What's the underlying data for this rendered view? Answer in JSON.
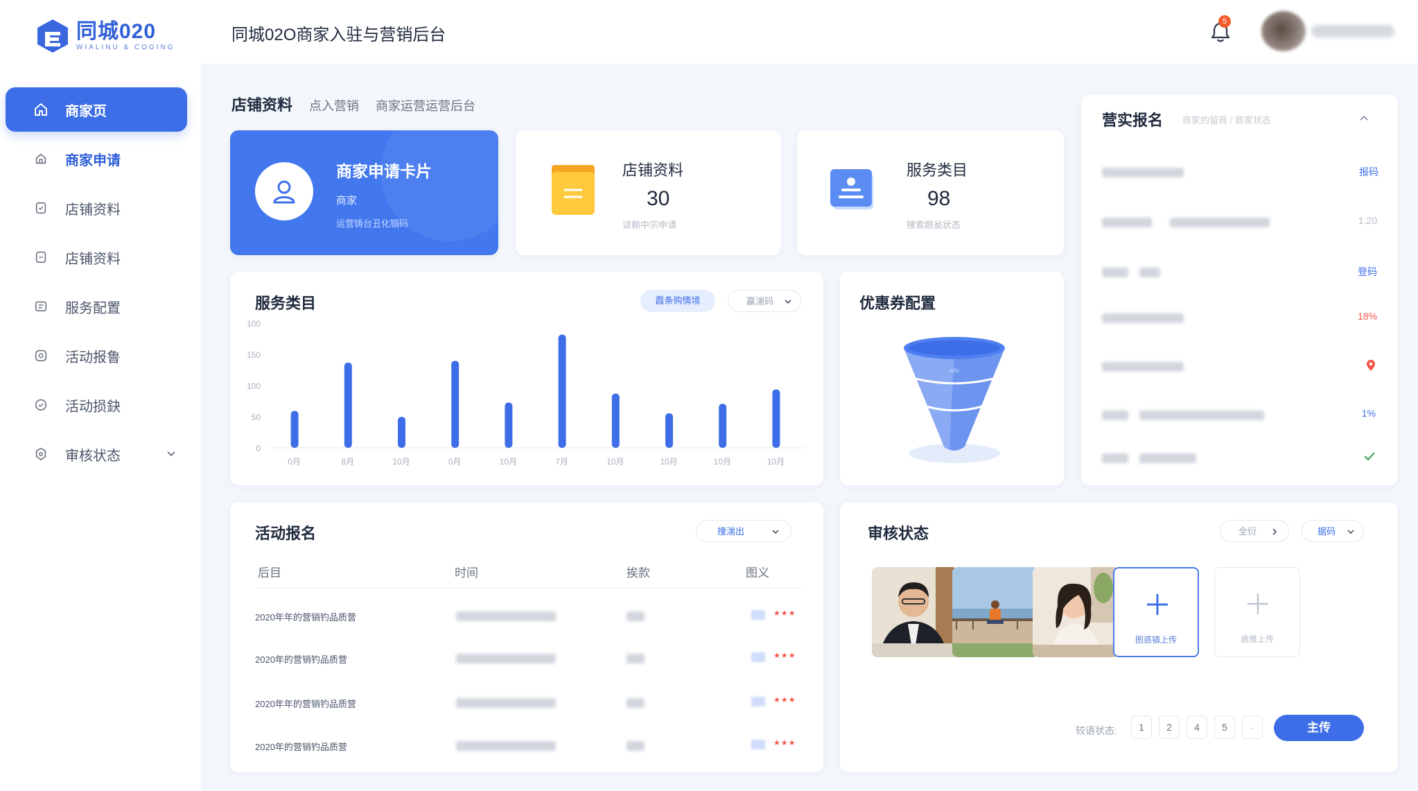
{
  "app": {
    "name": "同城020",
    "tagline": "WIALINU & COGING"
  },
  "header": {
    "title": "同城02O商家入驻与营销后台",
    "notification_count": "5"
  },
  "sidebar": {
    "items": [
      {
        "label": "商家页",
        "icon": "home-icon",
        "state": "active"
      },
      {
        "label": "商家申请",
        "icon": "home-outline-icon",
        "state": "highlight"
      },
      {
        "label": "店铺资料",
        "icon": "shield-doc-icon",
        "state": "normal"
      },
      {
        "label": "店铺资料",
        "icon": "document-icon",
        "state": "normal"
      },
      {
        "label": "服务配置",
        "icon": "list-box-icon",
        "state": "normal"
      },
      {
        "label": "活动报鲁",
        "icon": "target-icon",
        "state": "normal"
      },
      {
        "label": "活动损鈌",
        "icon": "check-circle-icon",
        "state": "normal"
      },
      {
        "label": "审核状态",
        "icon": "gear-shield-icon",
        "state": "normal",
        "has_submenu": true
      }
    ]
  },
  "tabs": [
    {
      "label": "店铺资料",
      "active": true
    },
    {
      "label": "点入营销",
      "active": false
    },
    {
      "label": "商家运营运营后台",
      "active": false
    }
  ],
  "merchant_card": {
    "title": "商家申请卡片",
    "subtitle": "商家",
    "note": "运营铸台丑化锢码"
  },
  "stat_cards": [
    {
      "title": "店铺资料",
      "value": "30",
      "note": "谅赖中宗申请"
    },
    {
      "title": "服务类目",
      "value": "98",
      "note": "搜索颇瓮状态"
    }
  ],
  "chart_panel": {
    "title": "服务类目",
    "filter_pill": "霞条购情境",
    "dropdown": "赢湍码"
  },
  "chart_data": {
    "type": "bar",
    "categories": [
      "0月",
      "8月",
      "10月",
      "0月",
      "10月",
      "7月",
      "10月",
      "10月",
      "10月",
      "10月"
    ],
    "values": [
      62,
      143,
      52,
      146,
      76,
      190,
      91,
      58,
      74,
      98
    ],
    "y_ticks": [
      "100",
      "150",
      "100",
      "50",
      "0"
    ],
    "color": "#3d6ee8",
    "grid": false,
    "xlabel": "",
    "ylabel": ""
  },
  "coupon_panel": {
    "title": "优惠券配置",
    "funnel_caption": "≈/≈"
  },
  "registration_panel": {
    "title": "营实报名",
    "breadcrumb": "商家的留商 / 商家状态",
    "rows": [
      {
        "value": "报码",
        "kind": "text"
      },
      {
        "value": "1.20",
        "kind": "gray"
      },
      {
        "value": "登码",
        "kind": "text"
      },
      {
        "value": "18%",
        "kind": "red"
      },
      {
        "value": "",
        "kind": "pin"
      },
      {
        "value": "1%",
        "kind": "text"
      },
      {
        "value": "",
        "kind": "check"
      }
    ]
  },
  "activity_panel": {
    "title": "活动报名",
    "dropdown": "撞湍出",
    "columns": [
      "后目",
      "时间",
      "挨款",
      "图义"
    ],
    "rows": [
      {
        "name": "2020年年的营销钓品质营"
      },
      {
        "name": "2020年的营销钓品质营"
      },
      {
        "name": "2020年年的营销钓品质营"
      },
      {
        "name": "2020年的营销钓品质营"
      }
    ]
  },
  "review_panel": {
    "title": "审核状态",
    "btn_all": "全衍",
    "btn_filter": "据码",
    "upload_active_label": "图惑镇上传",
    "upload_label": "歳雅上传",
    "pager_label": "较语状态:",
    "pages": [
      "1",
      "2",
      "4",
      "5",
      "-"
    ],
    "primary_button": "主传"
  }
}
